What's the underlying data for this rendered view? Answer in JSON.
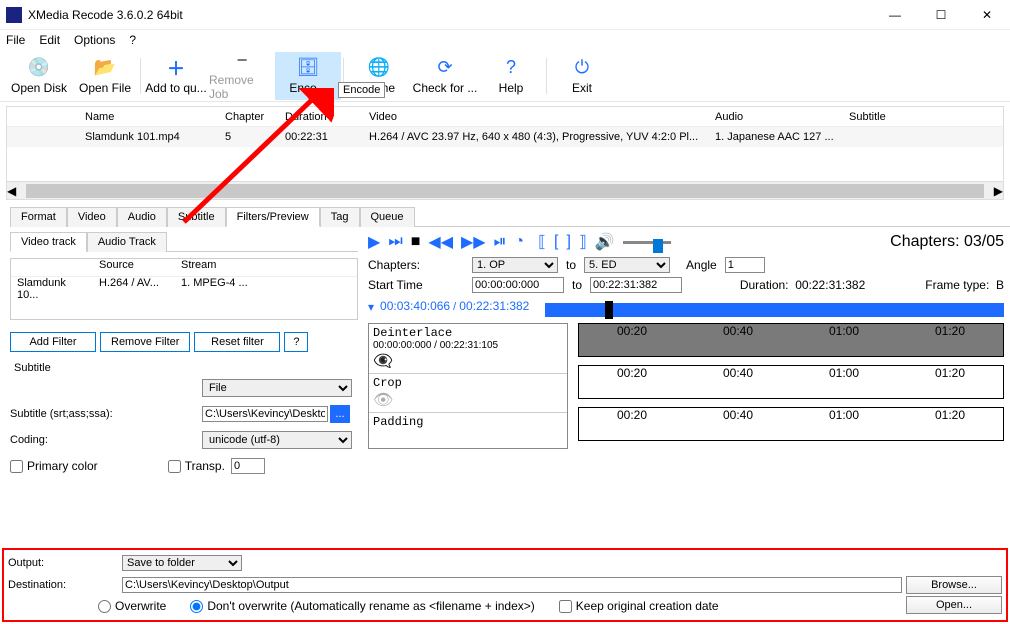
{
  "window": {
    "title": "XMedia Recode 3.6.0.2 64bit"
  },
  "menu": {
    "file": "File",
    "edit": "Edit",
    "options": "Options",
    "help": "?"
  },
  "toolbar": {
    "open_disk": "Open Disk",
    "open_file": "Open File",
    "add_queue": "Add to qu...",
    "remove_job": "Remove Job",
    "encode": "Enco...",
    "home": "Home",
    "check": "Check for ...",
    "help": "Help",
    "exit": "Exit",
    "tooltip": "Encode"
  },
  "filetable": {
    "headers": {
      "name": "Name",
      "chapters": "Chapter",
      "duration": "Duration",
      "video": "Video",
      "audio": "Audio",
      "subtitle": "Subtitle"
    },
    "rows": [
      {
        "name": "Slamdunk 101.mp4",
        "chapters": "5",
        "duration": "00:22:31",
        "video": "H.264 / AVC  23.97 Hz, 640 x 480 (4:3), Progressive, YUV 4:2:0 Pl...",
        "audio": "1. Japanese AAC  127 ...",
        "subtitle": ""
      }
    ]
  },
  "tabs1": [
    "Format",
    "Video",
    "Audio",
    "Subtitle",
    "Filters/Preview",
    "Tag",
    "Queue"
  ],
  "tabs1_active": "Filters/Preview",
  "tabs2": [
    "Video track",
    "Audio Track"
  ],
  "tabs2_active": "Video track",
  "tracktable": {
    "headers": {
      "c0": "",
      "c1": "Source",
      "c2": "Stream"
    },
    "rows": [
      {
        "c0": "Slamdunk 10...",
        "c1": "H.264 / AV...",
        "c2": "1. MPEG-4 ..."
      }
    ]
  },
  "filter_buttons": {
    "add": "Add Filter",
    "remove": "Remove Filter",
    "reset": "Reset filter",
    "q": "?"
  },
  "subtitle_panel": {
    "group": "Subtitle",
    "source_sel": "File",
    "file_label": "Subtitle (srt;ass;ssa):",
    "file_path": "C:\\Users\\Kevincy\\Deskto",
    "coding_label": "Coding:",
    "coding_sel": "unicode (utf-8)",
    "primary_color": "Primary color",
    "transp": "Transp.",
    "transp_val": "0"
  },
  "preview": {
    "chapters_counter": "Chapters: 03/05",
    "chapters_label": "Chapters:",
    "chap_from": "1. OP",
    "to": "to",
    "chap_to": "5. ED",
    "angle_label": "Angle",
    "angle_val": "1",
    "start_label": "Start Time",
    "start_from": "00:00:00:000",
    "start_to": "00:22:31:382",
    "duration_label": "Duration:",
    "duration_val": "00:22:31:382",
    "frametype_label": "Frame type:",
    "frametype_val": "B",
    "pos_cur": "00:03:40:066",
    "pos_total": "00:22:31:382"
  },
  "filter_list": [
    {
      "name": "Deinterlace",
      "range": "00:00:00:000 / 00:22:31:105",
      "eye": "strike"
    },
    {
      "name": "Crop",
      "range": "",
      "eye": "dim"
    },
    {
      "name": "Padding",
      "range": "",
      "eye": ""
    }
  ],
  "track_ticks": [
    "00:20",
    "00:40",
    "01:00",
    "01:20"
  ],
  "dest": {
    "output_label": "Output:",
    "output_sel": "Save to folder",
    "dest_label": "Destination:",
    "dest_path": "C:\\Users\\Kevincy\\Desktop\\Output",
    "browse": "Browse...",
    "open": "Open...",
    "overwrite": "Overwrite",
    "dont_overwrite": "Don't overwrite (Automatically rename as <filename + index>)",
    "keep_date": "Keep original creation date"
  }
}
